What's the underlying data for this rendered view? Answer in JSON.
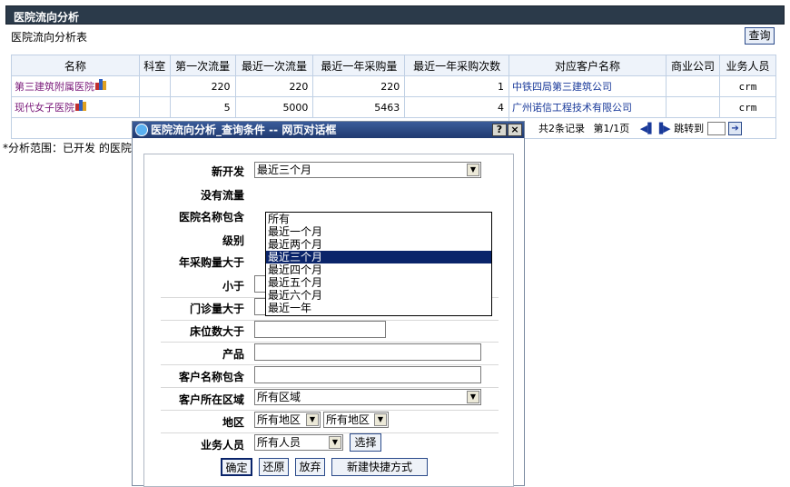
{
  "header": {
    "title": "医院流向分析"
  },
  "subtitle": "医院流向分析表",
  "query_label": "查询",
  "table": {
    "columns": [
      "名称",
      "科室",
      "第一次流量",
      "最近一次流量",
      "最近一年采购量",
      "最近一年采购次数",
      "对应客户名称",
      "商业公司",
      "业务人员"
    ],
    "rows": [
      {
        "name": "第三建筑附属医院",
        "dept": "",
        "first": "220",
        "last": "220",
        "year_qty": "220",
        "year_count": "1",
        "customer": "中铁四局第三建筑公司",
        "company": "",
        "staff": "crm"
      },
      {
        "name": "现代女子医院",
        "dept": "",
        "first": "5",
        "last": "5000",
        "year_qty": "5463",
        "year_count": "4",
        "customer": "广州诺信工程技术有限公司",
        "company": "",
        "staff": "crm"
      }
    ],
    "pager": {
      "summary": "共2条记录",
      "page": "第1/1页",
      "jump": "跳转到"
    }
  },
  "scope": "*分析范围：已开发 的医院",
  "dialog": {
    "title": "医院流向分析_查询条件 -- 网页对话框",
    "help": "?",
    "close": "×",
    "fields": {
      "new_dev": "新开发",
      "no_flow": "没有流量",
      "hospital_name": "医院名称包含",
      "level": "级别",
      "annual_gt": "年采购量大于",
      "lt": "小于",
      "outpatient": "门诊量大于",
      "beds": "床位数大于",
      "product": "产品",
      "customer_name": "客户名称包含",
      "region": "客户所在区域",
      "area": "地区",
      "staff": "业务人员"
    },
    "new_dev_value": "最近三个月",
    "dropdown_options": [
      "所有",
      "最近一个月",
      "最近两个月",
      "最近三个月",
      "最近四个月",
      "最近五个月",
      "最近六个月",
      "最近一年"
    ],
    "region_value": "所有区域",
    "area_value1": "所有地区",
    "area_value2": "所有地区",
    "staff_value": "所有人员",
    "choose": "选择",
    "buttons": {
      "ok": "确定",
      "reset": "还原",
      "cancel": "放弃",
      "shortcut": "新建快捷方式"
    }
  }
}
